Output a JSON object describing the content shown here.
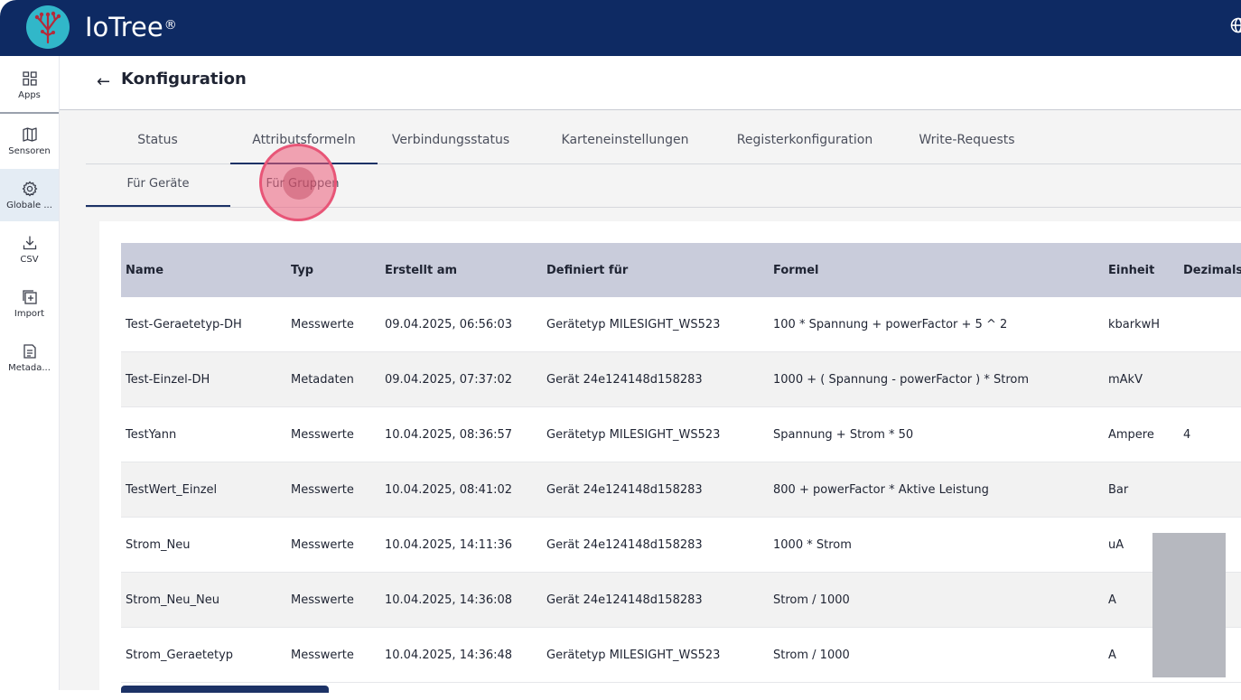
{
  "app": {
    "brand": "IoTree",
    "trademark": "®"
  },
  "sidebar": {
    "items": [
      {
        "label": "Apps",
        "icon": "grid-icon"
      },
      {
        "label": "Sensoren",
        "icon": "map-icon"
      },
      {
        "label": "Globale ...",
        "icon": "gear-icon"
      },
      {
        "label": "CSV",
        "icon": "download-icon"
      },
      {
        "label": "Import",
        "icon": "plus-square-icon"
      },
      {
        "label": "Metada...",
        "icon": "document-list-icon"
      }
    ]
  },
  "header": {
    "back": "←",
    "title": "Konfiguration"
  },
  "tabs": [
    "Status",
    "Attributsformeln",
    "Verbindungsstatus",
    "Karteneinstellungen",
    "Registerkonfiguration",
    "Write-Requests"
  ],
  "subtabs": [
    "Für Geräte",
    "Für Gruppen"
  ],
  "table": {
    "columns": [
      "Name",
      "Typ",
      "Erstellt am",
      "Definiert für",
      "Formel",
      "Einheit",
      "Dezimals"
    ],
    "rows": [
      [
        "Test-Geraetetyp-DH",
        "Messwerte",
        "09.04.2025, 06:56:03",
        "Gerätetyp MILESIGHT_WS523",
        "100 * Spannung + powerFactor + 5 ^ 2",
        "kbarkwH",
        ""
      ],
      [
        "Test-Einzel-DH",
        "Metadaten",
        "09.04.2025, 07:37:02",
        "Gerät 24e124148d158283",
        "1000 + ( Spannung - powerFactor ) * Strom",
        "mAkV",
        ""
      ],
      [
        "TestYann",
        "Messwerte",
        "10.04.2025, 08:36:57",
        "Gerätetyp MILESIGHT_WS523",
        "Spannung + Strom * 50",
        "Ampere",
        "4"
      ],
      [
        "TestWert_Einzel",
        "Messwerte",
        "10.04.2025, 08:41:02",
        "Gerät 24e124148d158283",
        "800 + powerFactor * Aktive Leistung",
        "Bar",
        ""
      ],
      [
        "Strom_Neu",
        "Messwerte",
        "10.04.2025, 14:11:36",
        "Gerät 24e124148d158283",
        "1000 * Strom",
        "uA",
        ""
      ],
      [
        "Strom_Neu_Neu",
        "Messwerte",
        "10.04.2025, 14:36:08",
        "Gerät 24e124148d158283",
        "Strom / 1000",
        "A",
        ""
      ],
      [
        "Strom_Geraetetyp",
        "Messwerte",
        "10.04.2025, 14:36:48",
        "Gerätetyp MILESIGHT_WS523",
        "Strom / 1000",
        "A",
        ""
      ]
    ]
  },
  "colors": {
    "topbar": "#0e2a63",
    "accent": "#1c3266",
    "header_row": "#c9ccdb",
    "logo": "#31b7c9",
    "click_highlight": "#e85577"
  }
}
